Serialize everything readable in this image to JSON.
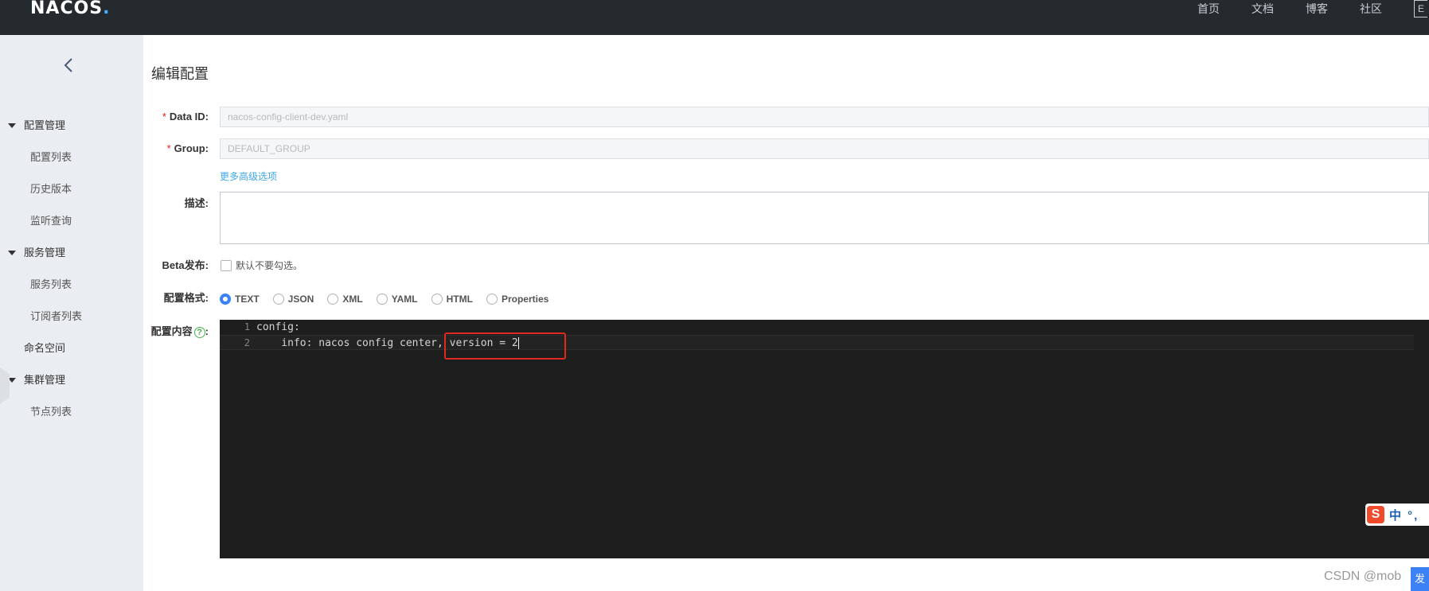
{
  "header": {
    "logo": "NACOS",
    "logo_dot": ".",
    "nav": [
      "首页",
      "文档",
      "博客",
      "社区"
    ],
    "lang": "E"
  },
  "sidebar": {
    "groups": [
      {
        "label": "配置管理",
        "items": [
          "配置列表",
          "历史版本",
          "监听查询"
        ]
      },
      {
        "label": "服务管理",
        "items": [
          "服务列表",
          "订阅者列表"
        ]
      },
      {
        "label": "命名空间",
        "items": []
      },
      {
        "label": "集群管理",
        "items": [
          "节点列表"
        ]
      }
    ]
  },
  "page": {
    "title": "编辑配置"
  },
  "form": {
    "data_id_label": "Data ID:",
    "data_id_value": "nacos-config-client-dev.yaml",
    "group_label": "Group:",
    "group_value": "DEFAULT_GROUP",
    "required_mark": "*",
    "advanced_link": "更多高级选项",
    "desc_label": "描述:",
    "beta_label": "Beta发布:",
    "beta_checkbox_text": "默认不要勾选。",
    "format_label": "配置格式:",
    "formats": [
      "TEXT",
      "JSON",
      "XML",
      "YAML",
      "HTML",
      "Properties"
    ],
    "selected_format": "TEXT",
    "content_label": "配置内容",
    "help_glyph": "?",
    "label_colon": ":"
  },
  "editor": {
    "lines": [
      {
        "num": "1",
        "text": "config:"
      },
      {
        "num": "2",
        "text": "    info: nacos config center, version = 2"
      }
    ]
  },
  "ime": {
    "logo": "S",
    "text": "中 °,"
  },
  "watermark": "CSDN @mob",
  "corner_button": "发",
  "colors": {
    "header_bg": "#252a2f",
    "sidebar_bg": "#eaedf1",
    "editor_bg": "#1e1e1e",
    "accent": "#3c82f6",
    "link": "#3fa7e8",
    "highlight": "#e02a20"
  }
}
